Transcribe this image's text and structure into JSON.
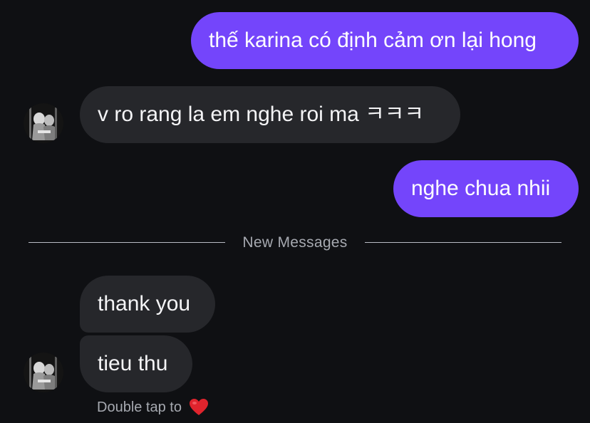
{
  "messages": [
    {
      "text": "thế karina có định cảm ơn lại hong",
      "direction": "sent"
    },
    {
      "text": "v ro rang la em nghe roi ma ㅋㅋㅋ",
      "direction": "received"
    },
    {
      "text": "nghe chua nhii",
      "direction": "sent"
    },
    {
      "text": "thank you",
      "direction": "received"
    },
    {
      "text": "tieu thu",
      "direction": "received"
    }
  ],
  "divider": {
    "label": "New Messages"
  },
  "reaction_hint": {
    "text": "Double tap to",
    "icon": "red-heart-icon"
  },
  "colors": {
    "background": "#0f1013",
    "sent_bubble": "#7445fb",
    "received_bubble": "#26272b",
    "muted_text": "#a6a9b0",
    "heart": "#e0242d"
  }
}
